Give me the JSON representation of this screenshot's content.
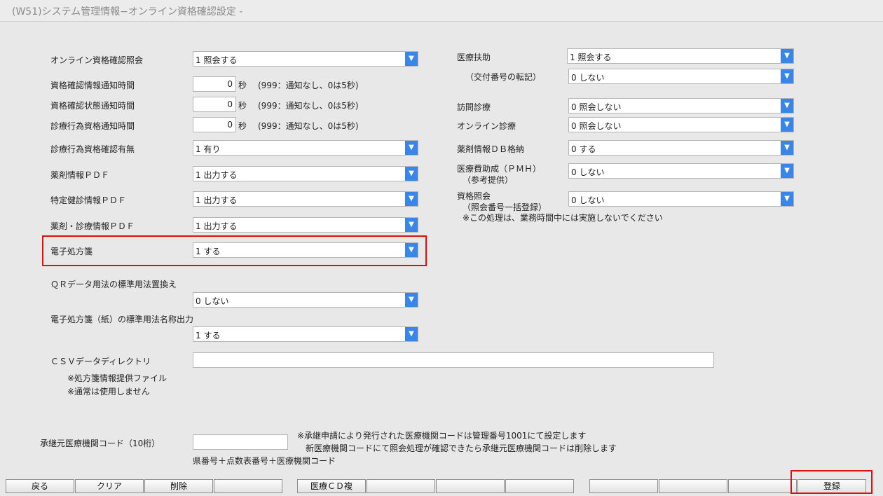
{
  "title": "(W51)システム管理情報−オンライン資格確認設定 -",
  "left": {
    "online_query": {
      "label": "オンライン資格確認照会",
      "value": "1 照会する"
    },
    "info_notify": {
      "label": "資格確認情報通知時間",
      "value": "0",
      "unit": "秒",
      "note": "(999：通知なし、0は5秒)"
    },
    "status_notify": {
      "label": "資格確認状態通知時間",
      "value": "0",
      "unit": "秒",
      "note": "(999：通知なし、0は5秒)"
    },
    "act_notify": {
      "label": "診療行為資格通知時間",
      "value": "0",
      "unit": "秒",
      "note": "(999：通知なし、0は5秒)"
    },
    "act_confirm": {
      "label": "診療行為資格確認有無",
      "value": "1 有り"
    },
    "drug_pdf": {
      "label": "薬剤情報ＰＤＦ",
      "value": "1 出力する"
    },
    "checkup_pdf": {
      "label": "特定健診情報ＰＤＦ",
      "value": "1 出力する"
    },
    "drug_med_pdf": {
      "label": "薬剤・診療情報ＰＤＦ",
      "value": "1 出力する"
    },
    "eprescription": {
      "label": "電子処方箋",
      "value": "1 する"
    },
    "qr_usage": {
      "label": "ＱＲデータ用法の標準用法置換え",
      "value": "0 しない"
    },
    "paper_usage": {
      "label": "電子処方箋（紙）の標準用法名称出力",
      "value": "1 する"
    },
    "csv_dir": {
      "label": "ＣＳＶデータディレクトリ",
      "value": "",
      "note1": "※処方箋情報提供ファイル",
      "note2": "※通常は使用しません"
    },
    "inherit_code": {
      "label": "承継元医療機関コード（10桁）",
      "value": "",
      "sub": "県番号＋点数表番号＋医療機関コード",
      "note1": "※承継申請により発行された医療機関コードは管理番号1001にて設定します",
      "note2": "新医療機関コードにて照会処理が確認できたら承継元医療機関コードは削除します"
    }
  },
  "right": {
    "medical_aid": {
      "label": "医療扶助",
      "value": "1 照会する"
    },
    "issue_no": {
      "label": "（交付番号の転記）",
      "value": "0 しない"
    },
    "home_visit": {
      "label": "訪問診療",
      "value": "0 照会しない"
    },
    "online_care": {
      "label": "オンライン診療",
      "value": "0 照会しない"
    },
    "drug_db": {
      "label": "薬剤情報ＤＢ格納",
      "value": "0 する"
    },
    "pmh": {
      "label1": "医療費助成（ＰＭＨ）",
      "label2": "（参考提供）",
      "value": "0 しない"
    },
    "qual_query": {
      "label1": "資格照会",
      "label2": "（照会番号一括登録）",
      "value": "0 しない",
      "note": "※この処理は、業務時間中には実施しないでください"
    }
  },
  "footer": {
    "buttons": [
      "戻る",
      "クリア",
      "削除",
      "",
      "医療ＣＤ複",
      "",
      "",
      "",
      "",
      "",
      "",
      "登録"
    ]
  }
}
